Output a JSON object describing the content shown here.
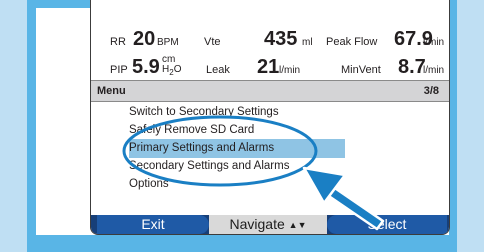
{
  "readouts": {
    "row1": {
      "rr_label": "RR",
      "rr_value": "20",
      "rr_unit": "BPM",
      "vte_label": "Vte",
      "vte_value": "435",
      "vte_unit": "ml",
      "peak_label": "Peak Flow",
      "peak_value": "67.9",
      "peak_unit": "l/min"
    },
    "row2": {
      "pip_label": "PIP",
      "pip_value": "5.9",
      "pip_unit_top": "cm",
      "pip_unit_h": "H",
      "pip_unit_sub": "2",
      "pip_unit_o": "O",
      "leak_label": "Leak",
      "leak_value": "21",
      "leak_unit": "l/min",
      "minvent_label": "MinVent",
      "minvent_value": "8.7",
      "minvent_unit": "l/min"
    }
  },
  "menu": {
    "title": "Menu",
    "page": "3/8",
    "items": [
      {
        "label": "Switch to Secondary Settings"
      },
      {
        "label": "Safely Remove SD Card"
      },
      {
        "label": "Primary Settings and Alarms"
      },
      {
        "label": "Secondary Settings and Alarms"
      },
      {
        "label": "Options"
      }
    ],
    "selected_index": 2
  },
  "softkeys": {
    "exit": "Exit",
    "navigate": "Navigate",
    "navigate_icon": "▲▼",
    "select": "Select"
  },
  "colors": {
    "highlight": "#8fc4e4",
    "callout": "#1a7fc4",
    "softkey": "#1f5aa6"
  }
}
